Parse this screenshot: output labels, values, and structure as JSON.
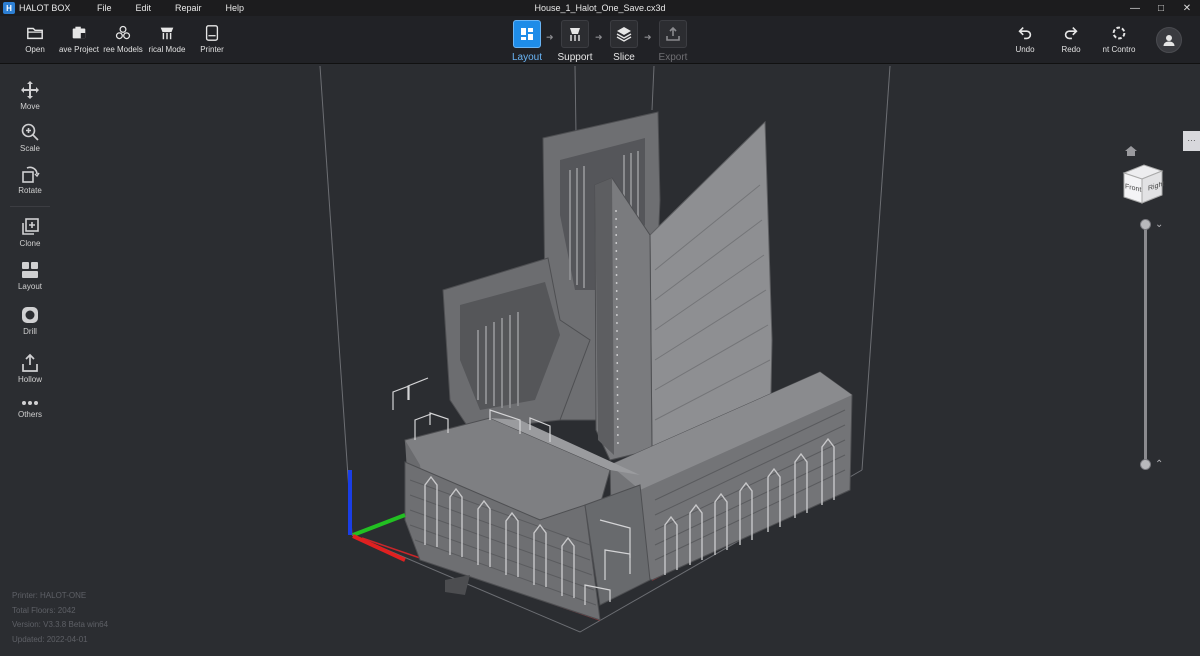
{
  "titlebar": {
    "app_name": "HALOT BOX",
    "document_title": "House_1_Halot_One_Save.cx3d",
    "menu": [
      "File",
      "Edit",
      "Repair",
      "Help"
    ]
  },
  "toolbar": {
    "open_label": "Open",
    "save_project_label": "ave Project",
    "tree_models_label": "ree Models",
    "vertical_mode_label": "rical Mode",
    "printer_label": "Printer",
    "undo_label": "Undo",
    "redo_label": "Redo",
    "print_control_label": "nt Contro"
  },
  "workflow": {
    "steps": [
      {
        "label": "Layout",
        "state": "active"
      },
      {
        "label": "Support",
        "state": "normal"
      },
      {
        "label": "Slice",
        "state": "normal"
      },
      {
        "label": "Export",
        "state": "disabled"
      }
    ]
  },
  "tools": {
    "move": "Move",
    "scale": "Scale",
    "rotate": "Rotate",
    "clone": "Clone",
    "layout": "Layout",
    "drill": "Drill",
    "hollow": "Hollow",
    "others": "Others"
  },
  "viewcube": {
    "front_label": "Front",
    "right_label": "Right"
  },
  "info": {
    "printer": "Printer: HALOT-ONE",
    "total_floors": "Total Floors: 2042",
    "version": "Version: V3.3.8 Beta win64",
    "updated": "Updated: 2022-04-01"
  },
  "colors": {
    "accent": "#1e8ce8",
    "background": "#2b2d31",
    "toolbar": "#212226",
    "axis_x": "#e02020",
    "axis_y": "#22c022",
    "axis_z": "#1a3ee6"
  }
}
